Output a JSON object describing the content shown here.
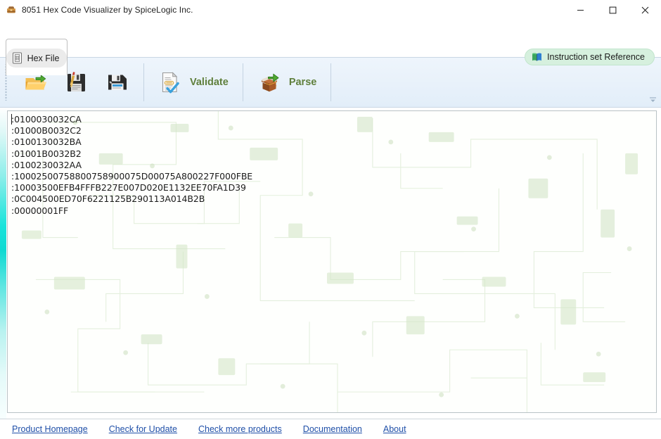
{
  "window": {
    "title": "8051 Hex Code Visualizer by SpiceLogic Inc.",
    "app_icon": "toolbox-icon",
    "controls": {
      "minimize": "minimize-icon",
      "maximize": "maximize-icon",
      "close": "close-icon"
    }
  },
  "tabs": [
    {
      "label": "Hex File",
      "icon": "hex-file-icon",
      "selected": true
    }
  ],
  "reference_button": {
    "label": "Instruction set Reference",
    "icon": "book-icon",
    "background": "#d6f0de"
  },
  "toolbar": {
    "buttons": [
      {
        "label": "",
        "icon": "open-folder-icon",
        "tooltip": "Open"
      },
      {
        "label": "",
        "icon": "save-edit-icon",
        "tooltip": "Save"
      },
      {
        "label": "",
        "icon": "save-as-icon",
        "tooltip": "Save As"
      },
      {
        "label": "Validate",
        "icon": "validate-document-icon"
      },
      {
        "label": "Parse",
        "icon": "parse-box-icon"
      }
    ],
    "overflow_icon": "chevron-down-icon",
    "label_color": "#5f7f3c",
    "background": "#e8f1fa"
  },
  "editor": {
    "lines": [
      ":0100030032CA",
      ":01000B0032C2",
      ":0100130032BA",
      ":01001B0032B2",
      ":0100230032AA",
      ":10002500758800758900075D00075A800227F000FBE",
      ":10003500EFB4FFFB227E007D020E1132EE70FA1D39",
      ":0C004500ED70F6221125B290113A014B2B",
      ":00000001FF"
    ],
    "text_color": "#1b1b1b",
    "background": "#fefffd",
    "accent_strip": "#0fd9d2"
  },
  "statusbar": {
    "links": [
      "Product Homepage",
      "Check for Update",
      "Check more products",
      "Documentation",
      "About"
    ],
    "link_color": "#1f4fa8"
  }
}
